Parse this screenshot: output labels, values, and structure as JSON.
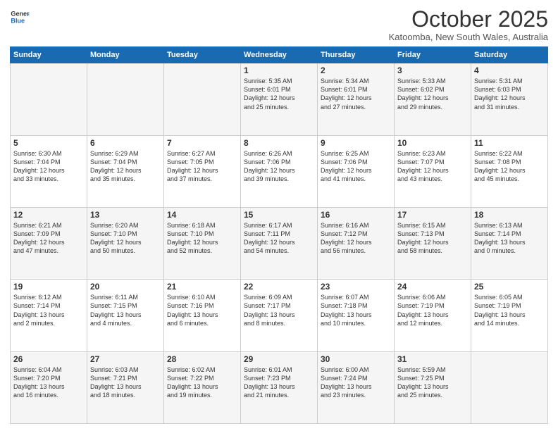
{
  "header": {
    "logo_line1": "General",
    "logo_line2": "Blue",
    "month": "October 2025",
    "location": "Katoomba, New South Wales, Australia"
  },
  "weekdays": [
    "Sunday",
    "Monday",
    "Tuesday",
    "Wednesday",
    "Thursday",
    "Friday",
    "Saturday"
  ],
  "weeks": [
    [
      {
        "day": "",
        "text": ""
      },
      {
        "day": "",
        "text": ""
      },
      {
        "day": "",
        "text": ""
      },
      {
        "day": "1",
        "text": "Sunrise: 5:35 AM\nSunset: 6:01 PM\nDaylight: 12 hours\nand 25 minutes."
      },
      {
        "day": "2",
        "text": "Sunrise: 5:34 AM\nSunset: 6:01 PM\nDaylight: 12 hours\nand 27 minutes."
      },
      {
        "day": "3",
        "text": "Sunrise: 5:33 AM\nSunset: 6:02 PM\nDaylight: 12 hours\nand 29 minutes."
      },
      {
        "day": "4",
        "text": "Sunrise: 5:31 AM\nSunset: 6:03 PM\nDaylight: 12 hours\nand 31 minutes."
      }
    ],
    [
      {
        "day": "5",
        "text": "Sunrise: 6:30 AM\nSunset: 7:04 PM\nDaylight: 12 hours\nand 33 minutes."
      },
      {
        "day": "6",
        "text": "Sunrise: 6:29 AM\nSunset: 7:04 PM\nDaylight: 12 hours\nand 35 minutes."
      },
      {
        "day": "7",
        "text": "Sunrise: 6:27 AM\nSunset: 7:05 PM\nDaylight: 12 hours\nand 37 minutes."
      },
      {
        "day": "8",
        "text": "Sunrise: 6:26 AM\nSunset: 7:06 PM\nDaylight: 12 hours\nand 39 minutes."
      },
      {
        "day": "9",
        "text": "Sunrise: 6:25 AM\nSunset: 7:06 PM\nDaylight: 12 hours\nand 41 minutes."
      },
      {
        "day": "10",
        "text": "Sunrise: 6:23 AM\nSunset: 7:07 PM\nDaylight: 12 hours\nand 43 minutes."
      },
      {
        "day": "11",
        "text": "Sunrise: 6:22 AM\nSunset: 7:08 PM\nDaylight: 12 hours\nand 45 minutes."
      }
    ],
    [
      {
        "day": "12",
        "text": "Sunrise: 6:21 AM\nSunset: 7:09 PM\nDaylight: 12 hours\nand 47 minutes."
      },
      {
        "day": "13",
        "text": "Sunrise: 6:20 AM\nSunset: 7:10 PM\nDaylight: 12 hours\nand 50 minutes."
      },
      {
        "day": "14",
        "text": "Sunrise: 6:18 AM\nSunset: 7:10 PM\nDaylight: 12 hours\nand 52 minutes."
      },
      {
        "day": "15",
        "text": "Sunrise: 6:17 AM\nSunset: 7:11 PM\nDaylight: 12 hours\nand 54 minutes."
      },
      {
        "day": "16",
        "text": "Sunrise: 6:16 AM\nSunset: 7:12 PM\nDaylight: 12 hours\nand 56 minutes."
      },
      {
        "day": "17",
        "text": "Sunrise: 6:15 AM\nSunset: 7:13 PM\nDaylight: 12 hours\nand 58 minutes."
      },
      {
        "day": "18",
        "text": "Sunrise: 6:13 AM\nSunset: 7:14 PM\nDaylight: 13 hours\nand 0 minutes."
      }
    ],
    [
      {
        "day": "19",
        "text": "Sunrise: 6:12 AM\nSunset: 7:14 PM\nDaylight: 13 hours\nand 2 minutes."
      },
      {
        "day": "20",
        "text": "Sunrise: 6:11 AM\nSunset: 7:15 PM\nDaylight: 13 hours\nand 4 minutes."
      },
      {
        "day": "21",
        "text": "Sunrise: 6:10 AM\nSunset: 7:16 PM\nDaylight: 13 hours\nand 6 minutes."
      },
      {
        "day": "22",
        "text": "Sunrise: 6:09 AM\nSunset: 7:17 PM\nDaylight: 13 hours\nand 8 minutes."
      },
      {
        "day": "23",
        "text": "Sunrise: 6:07 AM\nSunset: 7:18 PM\nDaylight: 13 hours\nand 10 minutes."
      },
      {
        "day": "24",
        "text": "Sunrise: 6:06 AM\nSunset: 7:19 PM\nDaylight: 13 hours\nand 12 minutes."
      },
      {
        "day": "25",
        "text": "Sunrise: 6:05 AM\nSunset: 7:19 PM\nDaylight: 13 hours\nand 14 minutes."
      }
    ],
    [
      {
        "day": "26",
        "text": "Sunrise: 6:04 AM\nSunset: 7:20 PM\nDaylight: 13 hours\nand 16 minutes."
      },
      {
        "day": "27",
        "text": "Sunrise: 6:03 AM\nSunset: 7:21 PM\nDaylight: 13 hours\nand 18 minutes."
      },
      {
        "day": "28",
        "text": "Sunrise: 6:02 AM\nSunset: 7:22 PM\nDaylight: 13 hours\nand 19 minutes."
      },
      {
        "day": "29",
        "text": "Sunrise: 6:01 AM\nSunset: 7:23 PM\nDaylight: 13 hours\nand 21 minutes."
      },
      {
        "day": "30",
        "text": "Sunrise: 6:00 AM\nSunset: 7:24 PM\nDaylight: 13 hours\nand 23 minutes."
      },
      {
        "day": "31",
        "text": "Sunrise: 5:59 AM\nSunset: 7:25 PM\nDaylight: 13 hours\nand 25 minutes."
      },
      {
        "day": "",
        "text": ""
      }
    ]
  ]
}
